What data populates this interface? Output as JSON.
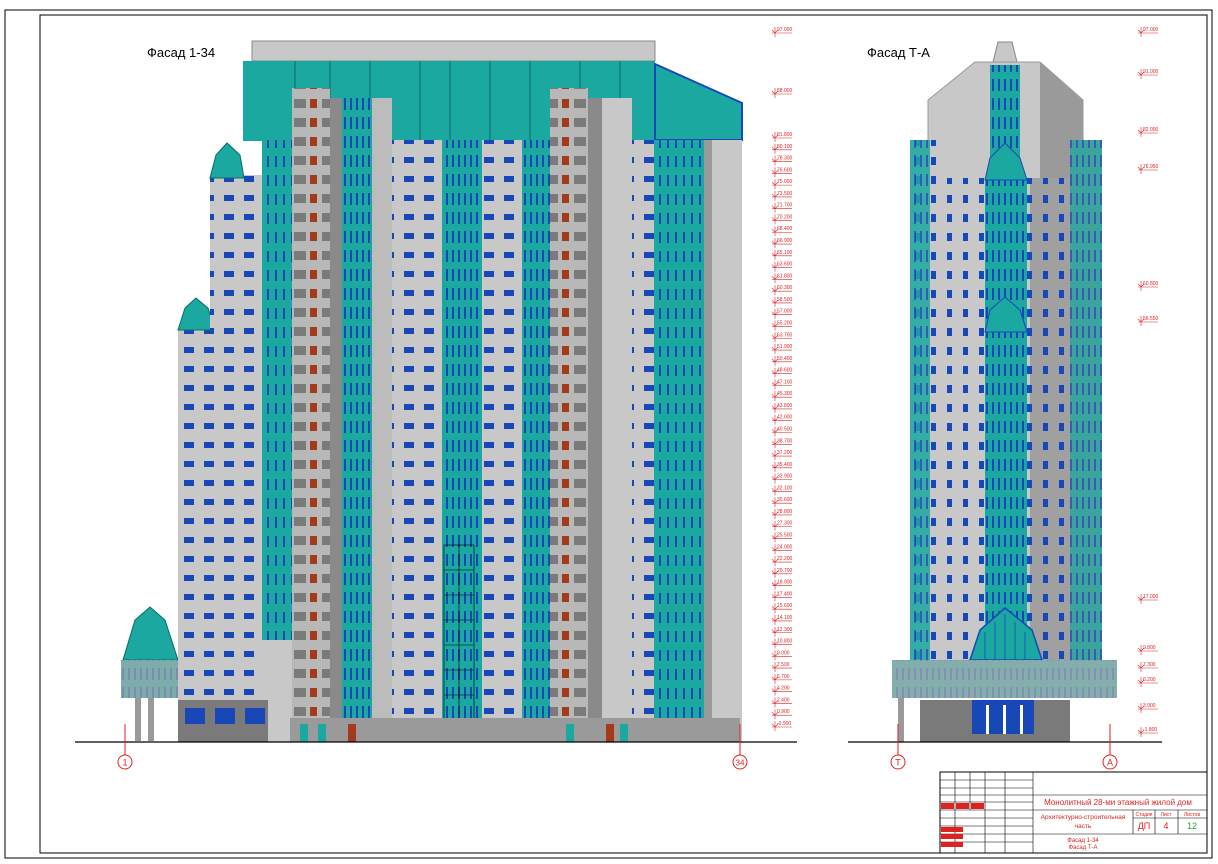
{
  "titles": {
    "facade_left": "Фасад 1-34",
    "facade_right": "Фасад Т-А"
  },
  "axes": {
    "left_start": "1",
    "left_end": "34",
    "right_start": "Т",
    "right_end": "А"
  },
  "elevations_left": [
    "97.000",
    "88.000",
    "81.800",
    "80.100",
    "78.300",
    "76.600",
    "75.000",
    "73.500",
    "71.700",
    "70.200",
    "68.400",
    "66.900",
    "65.100",
    "63.600",
    "61.800",
    "60.300",
    "58.500",
    "57.000",
    "55.200",
    "53.700",
    "51.900",
    "50.400",
    "48.600",
    "47.100",
    "45.300",
    "43.800",
    "42.000",
    "40.500",
    "38.700",
    "37.200",
    "35.400",
    "33.900",
    "32.100",
    "30.600",
    "28.800",
    "27.300",
    "25.500",
    "24.000",
    "22.200",
    "20.700",
    "18.900",
    "17.400",
    "15.600",
    "14.100",
    "12.300",
    "10.800",
    "9.000",
    "7.500",
    "5.700",
    "4.200",
    "2.400",
    "0.900",
    "-0.900"
  ],
  "elevations_right": [
    "97.000",
    "91.000",
    "82.000",
    "76.950",
    "60.800",
    "56.550",
    "17.000",
    "9.800",
    "7.300",
    "6.200",
    "3.900",
    "-1.800"
  ],
  "title_block": {
    "project": "Монолитный 28-ми этажный жилой дом",
    "section": "Архитектурно-строительная часть",
    "sheet_name_line1": "Фасад 1-34",
    "sheet_name_line2": "Фасад Т-А",
    "stage_header": "Стадия",
    "sheet_header": "Лист",
    "sheets_header": "Листов",
    "stage": "ДП",
    "sheet": "4",
    "sheets": "12"
  },
  "colors": {
    "teal": "#1aa8a0",
    "blue": "#1848b8",
    "brick": "#a33a1a",
    "grey": "#c8c8c8",
    "dark_grey": "#8a8a8a",
    "red_line": "#d22"
  }
}
